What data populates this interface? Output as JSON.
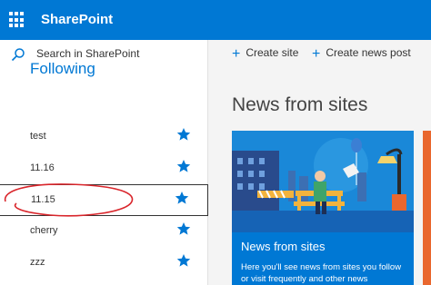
{
  "suite": {
    "brand": "SharePoint"
  },
  "search": {
    "placeholder": "Search in SharePoint"
  },
  "following": {
    "title": "Following",
    "items": [
      {
        "label": "test"
      },
      {
        "label": "11.16"
      },
      {
        "label": "11.15"
      },
      {
        "label": "cherry"
      },
      {
        "label": "zzz"
      }
    ]
  },
  "commands": {
    "create_site": "Create site",
    "create_news": "Create news post"
  },
  "news": {
    "title": "News from sites",
    "card_heading": "News from sites",
    "card_text": "Here you'll see news from sites you follow or visit frequently and other news"
  },
  "colors": {
    "accent": "#0078d4",
    "annotation": "#d9252b",
    "side_card": "#e9672e"
  },
  "icons": {
    "app_launcher": "waffle-icon",
    "search": "search-icon",
    "star": "star-filled-icon",
    "plus": "plus-icon"
  }
}
